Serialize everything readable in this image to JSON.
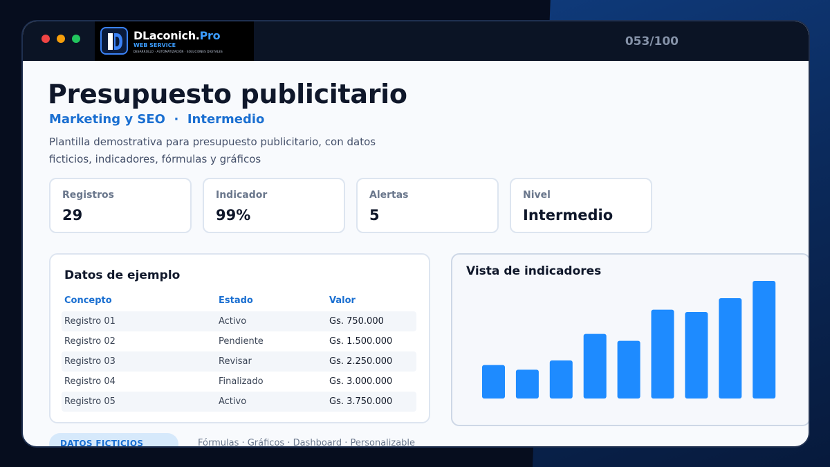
{
  "brand": {
    "name_main": "DLaconich.",
    "name_accent": "Pro",
    "service": "WEB SERVICE",
    "tagline": "DESARROLLO · AUTOMATIZACIÓN · SOLUCIONES DIGITALES"
  },
  "counter": "053/100",
  "title": "Presupuesto publicitario",
  "subtitle": "Marketing y SEO  ·  Intermedio",
  "description": "Plantilla demostrativa para presupuesto publicitario, con datos ficticios, indicadores, fórmulas y gráficos",
  "cards": [
    {
      "label": "Registros",
      "value": "29"
    },
    {
      "label": "Indicador",
      "value": "99%"
    },
    {
      "label": "Alertas",
      "value": "5"
    },
    {
      "label": "Nivel",
      "value": "Intermedio"
    }
  ],
  "table": {
    "title": "Datos de ejemplo",
    "headers": [
      "Concepto",
      "Estado",
      "Valor"
    ],
    "rows": [
      [
        "Registro 01",
        "Activo",
        "Gs. 750.000"
      ],
      [
        "Registro 02",
        "Pendiente",
        "Gs. 1.500.000"
      ],
      [
        "Registro 03",
        "Revisar",
        "Gs. 2.250.000"
      ],
      [
        "Registro 04",
        "Finalizado",
        "Gs. 3.000.000"
      ],
      [
        "Registro 05",
        "Activo",
        "Gs. 3.750.000"
      ]
    ]
  },
  "chart_data": {
    "type": "bar",
    "title": "Vista de indicadores",
    "categories": [
      "",
      "",
      "",
      "",
      "",
      "",
      "",
      "",
      ""
    ],
    "values": [
      29,
      25,
      33,
      56,
      50,
      77,
      75,
      87,
      102
    ],
    "ylim": [
      0,
      102
    ],
    "grid": false,
    "color": "#1e8bff"
  },
  "footer": {
    "badge": "DATOS FICTICIOS",
    "features": "Fórmulas · Gráficos · Dashboard · Personalizable"
  },
  "colors": {
    "accent": "#1a6fd1",
    "bar": "#1e8bff",
    "dark": "#0b1425"
  }
}
